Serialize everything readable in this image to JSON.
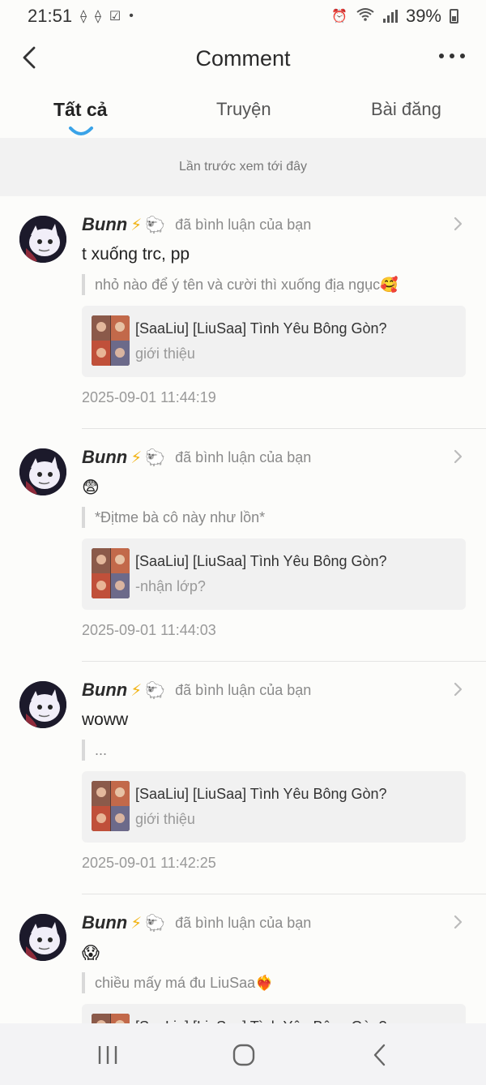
{
  "status_bar": {
    "time": "21:51",
    "battery": "39%",
    "left_icons": [
      "notification-icon-1",
      "notification-icon-2",
      "check-box-icon",
      "dot-icon"
    ],
    "right_icons": [
      "alarm-icon",
      "wifi-icon",
      "signal-icon",
      "battery-icon"
    ]
  },
  "header": {
    "title": "Comment"
  },
  "tabs": [
    {
      "label": "Tất cả",
      "active": true
    },
    {
      "label": "Truyện",
      "active": false
    },
    {
      "label": "Bài đăng",
      "active": false
    }
  ],
  "last_seen": "Lần trước xem tới đây",
  "comments": [
    {
      "user": "Bunn",
      "badge_bolt": "⚡",
      "badge_sheep": "🐑",
      "action": "đã bình luận của bạn",
      "text": "t xuống trc, pp",
      "quote": "nhỏ nào để ý tên và cười thì xuống địa ngục🥰",
      "card_title": "[SaaLiu] [LiuSaa] Tình Yêu Bông Gòn?",
      "card_subtitle": "giới thiệu",
      "timestamp": "2025-09-01 11:44:19"
    },
    {
      "user": "Bunn",
      "badge_bolt": "⚡",
      "badge_sheep": "🐑",
      "action": "đã bình luận của bạn",
      "text": "😨",
      "quote": "*Địtme bà cô này như lồn*",
      "card_title": "[SaaLiu] [LiuSaa] Tình Yêu Bông Gòn?",
      "card_subtitle": "-nhận lớp?",
      "timestamp": "2025-09-01 11:44:03"
    },
    {
      "user": "Bunn",
      "badge_bolt": "⚡",
      "badge_sheep": "🐑",
      "action": "đã bình luận của bạn",
      "text": "woww",
      "quote": "...",
      "card_title": "[SaaLiu] [LiuSaa] Tình Yêu Bông Gòn?",
      "card_subtitle": "giới thiệu",
      "timestamp": "2025-09-01 11:42:25"
    },
    {
      "user": "Bunn",
      "badge_bolt": "⚡",
      "badge_sheep": "🐑",
      "action": "đã bình luận của bạn",
      "text": "😱",
      "quote": "chiều mấy má đu LiuSaa❤️‍🔥",
      "card_title": "[SaaLiu] [LiuSaa] Tình Yêu Bông Gòn?",
      "card_subtitle": "",
      "timestamp": ""
    }
  ],
  "nav": [
    "recent-apps-icon",
    "home-icon",
    "back-icon"
  ]
}
